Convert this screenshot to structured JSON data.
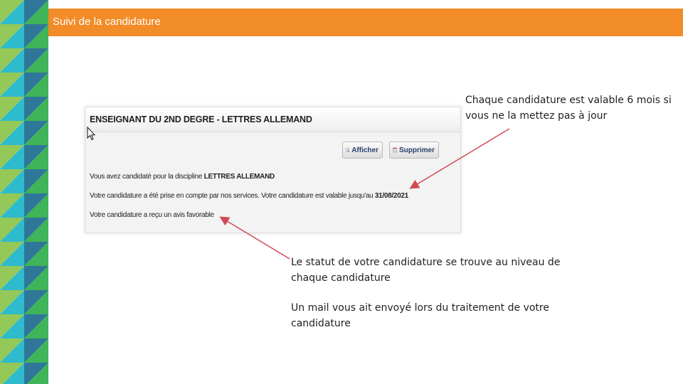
{
  "slide": {
    "title": "Suivi de la candidature"
  },
  "colors": {
    "header": "#f28c28",
    "arrow": "#d04a55",
    "deco": [
      "#8bc34a",
      "#1bb5c9",
      "#f44e56",
      "#ffc107",
      "#1d6b8f",
      "#2fae4a",
      "#ff6d3a"
    ]
  },
  "screenshot": {
    "title": "ENSEIGNANT DU 2ND DEGRE - LETTRES ALLEMAND",
    "buttons": {
      "show": {
        "label": "Afficher",
        "icon": "document-icon"
      },
      "delete": {
        "label": "Supprimer",
        "icon": "delete-document-icon"
      }
    },
    "line1": {
      "text": "Vous avez candidaté pour la discipline ",
      "bold": "LETTRES ALLEMAND"
    },
    "line2": {
      "text": "Votre candidature a été prise en compte par nos services. Votre candidature est valable jusqu'au ",
      "bold": "31/08/2021"
    },
    "line3": {
      "text": "Votre candidature a reçu un avis favorable"
    }
  },
  "callouts": {
    "validity": "Chaque candidature est valable 6 mois si vous ne la mettez pas à jour",
    "status": "Le statut de votre candidature se trouve au niveau de chaque candidature",
    "email": "Un mail vous ait envoyé lors du traitement de votre candidature"
  }
}
